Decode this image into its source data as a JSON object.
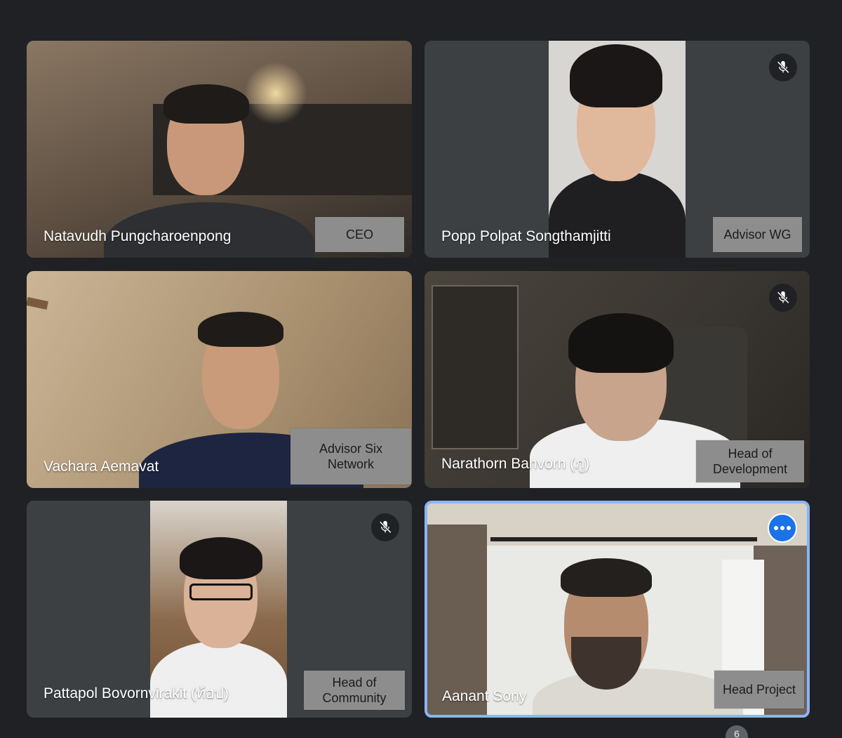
{
  "participants": [
    {
      "name": "Natavudh Pungcharoenpong",
      "role": "CEO",
      "muted": false
    },
    {
      "name": "Popp Polpat Songthamjitti",
      "role": "Advisor WG",
      "muted": true
    },
    {
      "name": "Vachara Aemavat",
      "role": "Advisor Six Network",
      "muted": false
    },
    {
      "name": "Narathorn Banvorn (ภู)",
      "role": "Head of Development",
      "muted": true
    },
    {
      "name": "Pattapol Bovornvirakit (ท้อป)",
      "role": "Head of Community",
      "muted": true
    },
    {
      "name": "Aanant Sony",
      "role": "Head Project",
      "muted": false,
      "active_speaker": true
    }
  ],
  "participant_count": "6",
  "icons": {
    "mute": "mic-off-icon",
    "more": "more-options-icon"
  },
  "colors": {
    "background": "#202124",
    "tile": "#3c4043",
    "active_border": "#8ab4f8",
    "more_button": "#1a73e8",
    "role_label": "#8d8d8d"
  }
}
